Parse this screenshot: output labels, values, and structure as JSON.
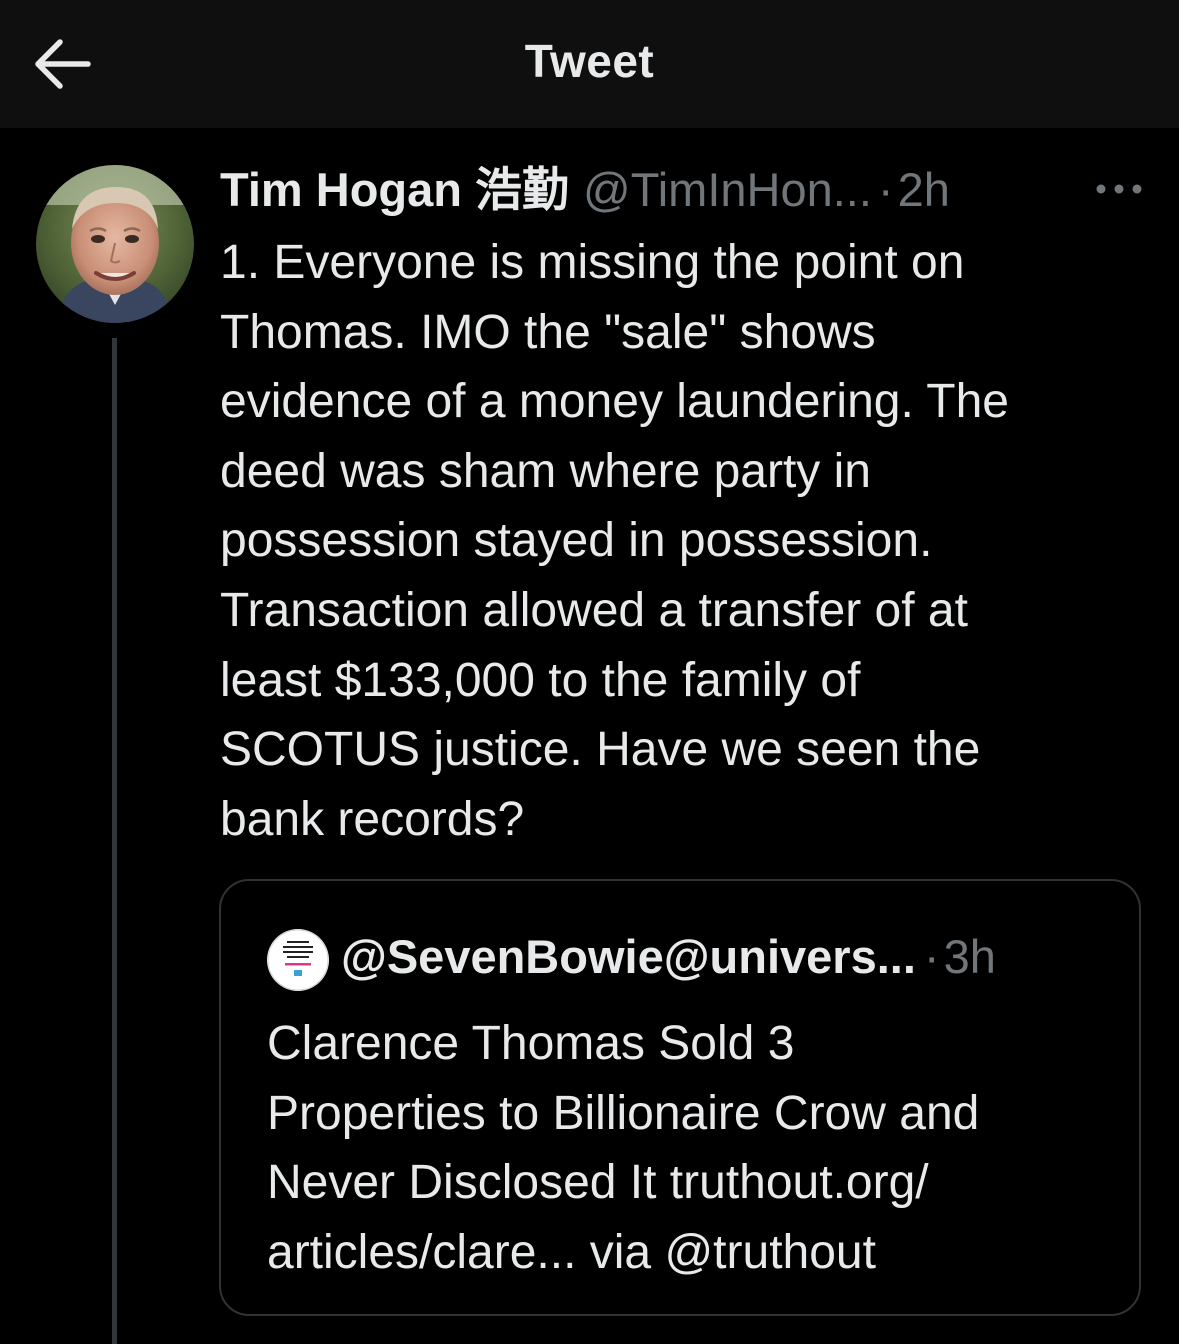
{
  "header": {
    "title": "Tweet",
    "back_icon": "arrow-left-icon"
  },
  "tweet": {
    "author_name": "Tim Hogan 浩勤",
    "author_handle": "@TimInHon...",
    "separator": "·",
    "time": "2h",
    "more_icon": "more-dots-icon",
    "avatar_icon": "user-avatar",
    "text": "1. Everyone is missing the point on\nThomas. IMO the \"sale\" shows\nevidence of a money laundering. The\ndeed was sham where party in\npossession stayed in possession.\nTransaction allowed a transfer of at\nleast  $133,000 to the family of\nSCOTUS justice. Have we seen the\nbank records?"
  },
  "quote": {
    "author": "@SevenBowie@univers...",
    "separator": "·",
    "time": "3h",
    "avatar_icon": "quote-avatar",
    "text": "Clarence Thomas Sold 3\nProperties to Billionaire Crow and\nNever Disclosed It truthout.org/\narticles/clare... via @truthout"
  },
  "colors": {
    "background": "#000000",
    "header_background": "#0f0f0f",
    "primary_text": "#e7e9ea",
    "secondary_text": "#71767b",
    "border": "#2f3336",
    "thread_line": "#333639"
  }
}
